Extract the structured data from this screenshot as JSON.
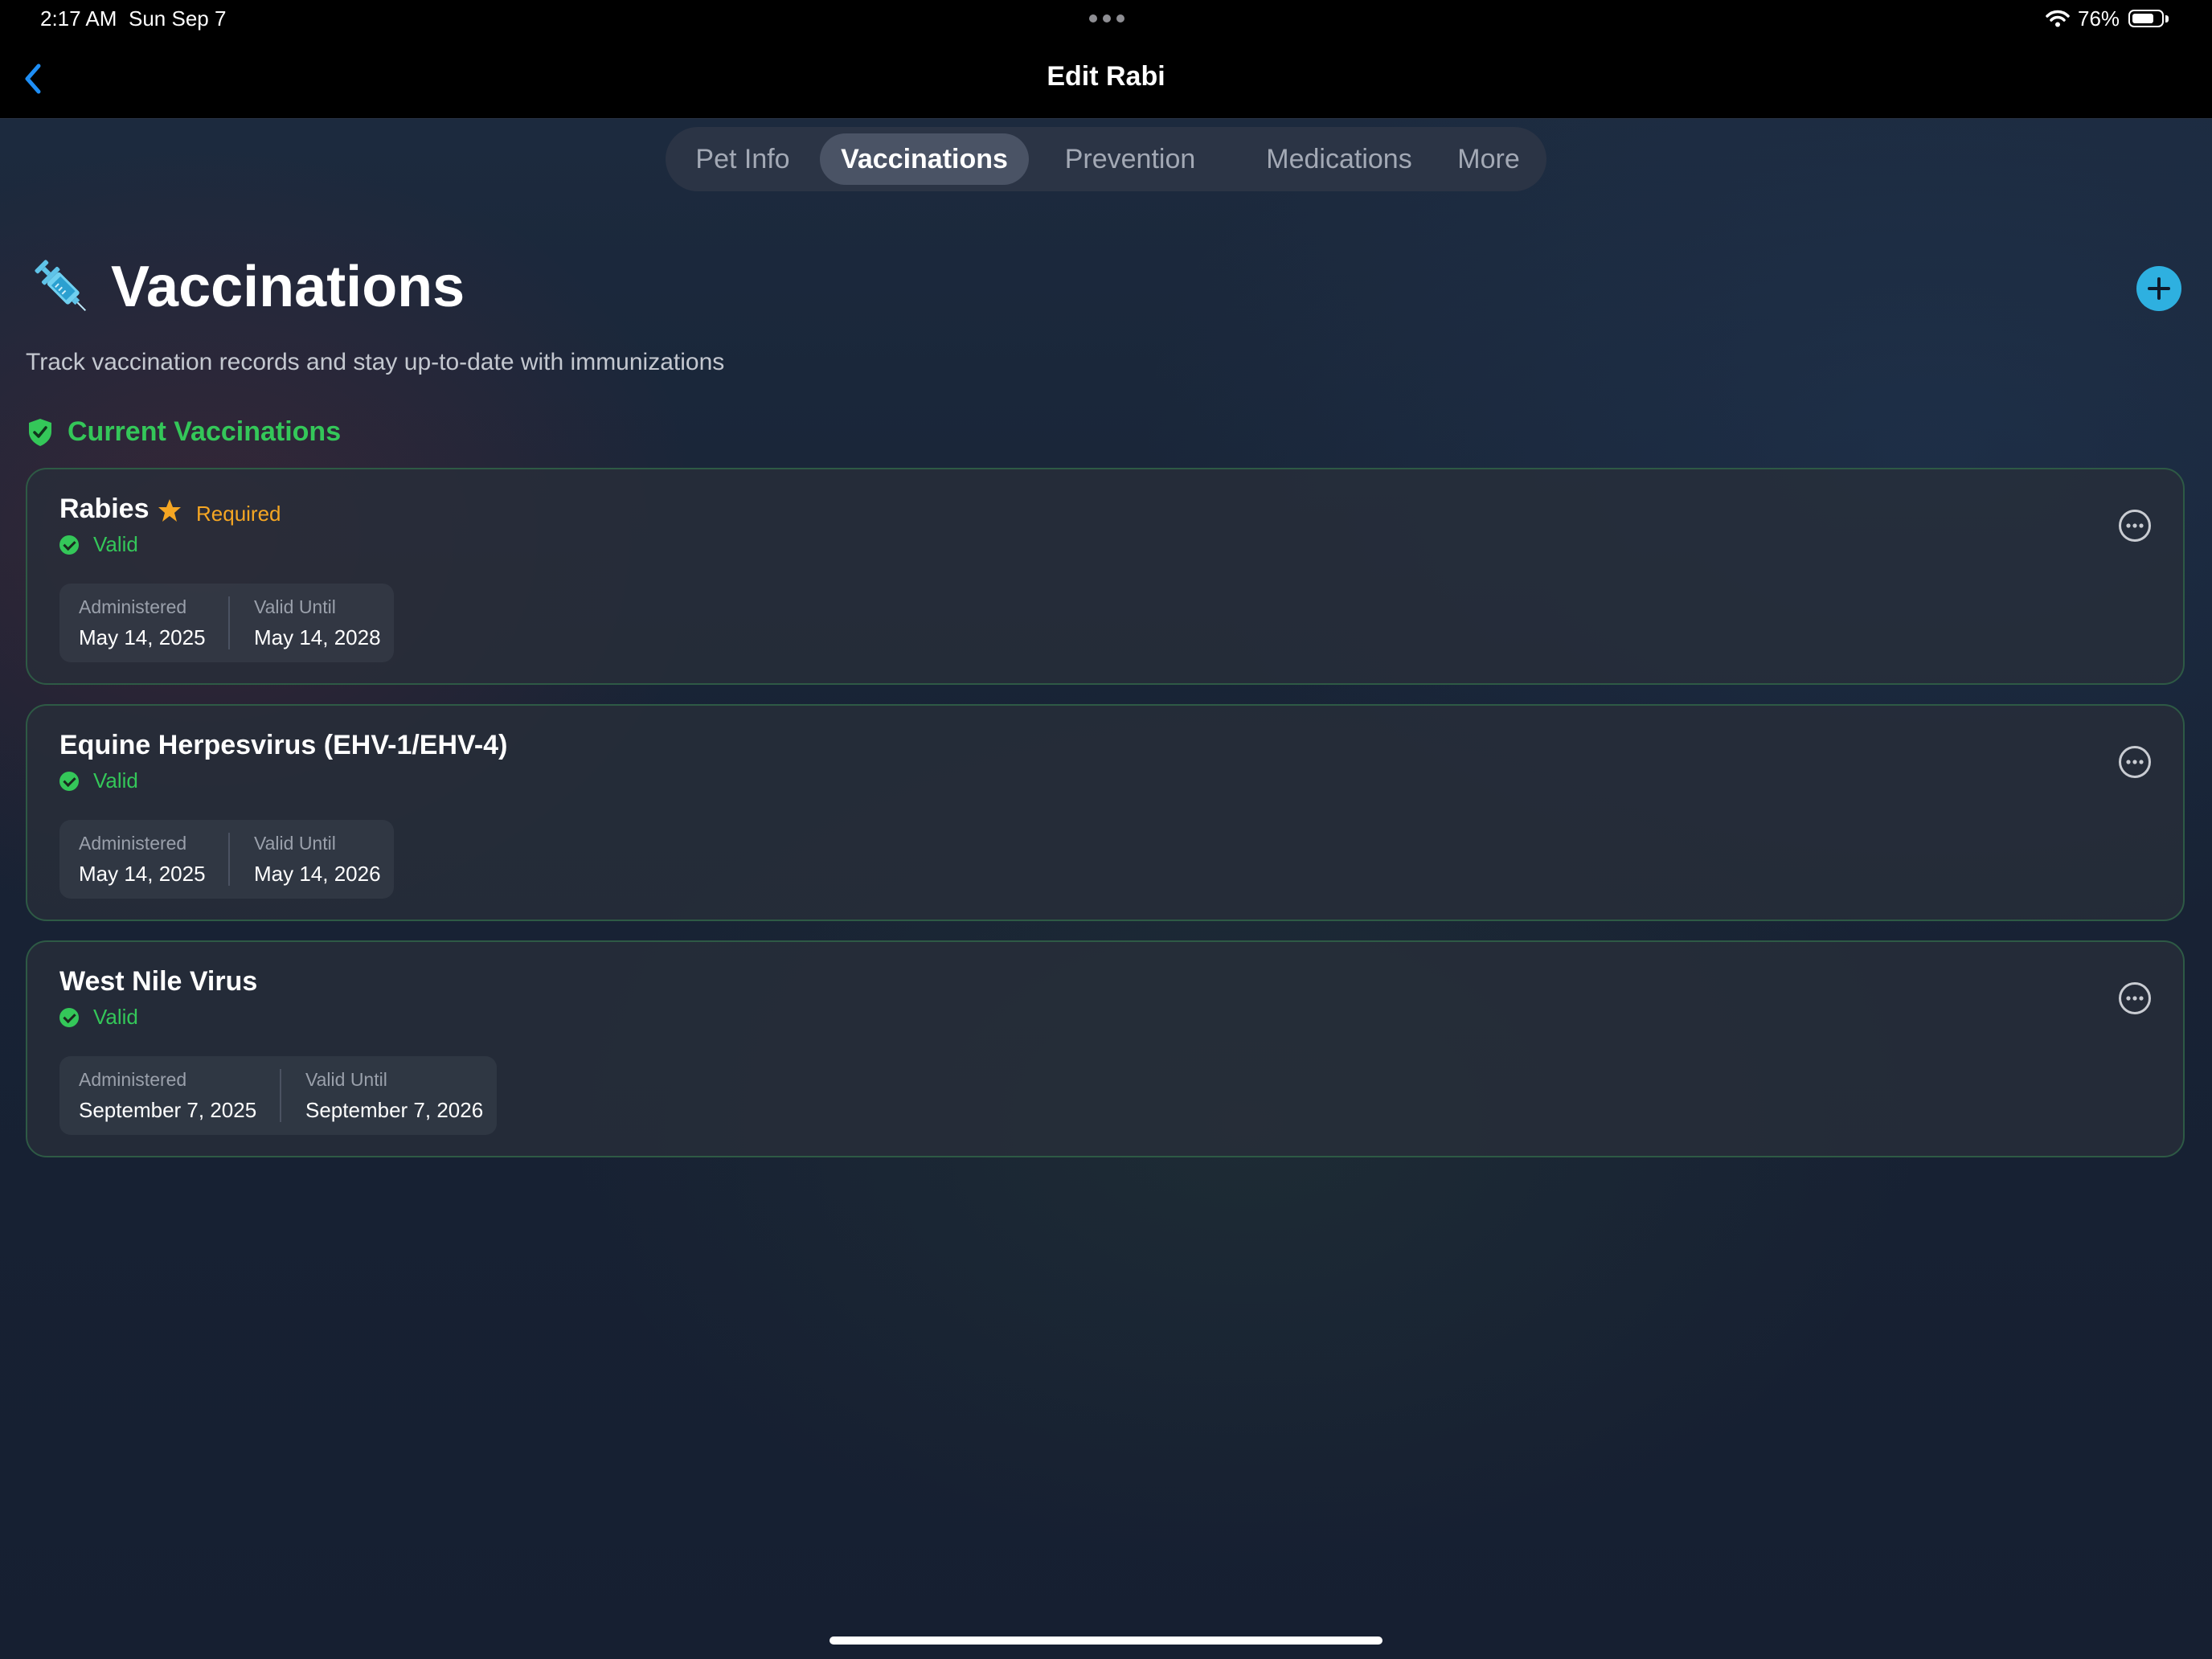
{
  "status_bar": {
    "time": "2:17 AM",
    "date": "Sun Sep 7",
    "battery_percent": "76%",
    "battery_level": 0.76
  },
  "nav": {
    "title": "Edit Rabi"
  },
  "tabs": [
    {
      "label": "Pet Info",
      "active": false
    },
    {
      "label": "Vaccinations",
      "active": true
    },
    {
      "label": "Prevention",
      "active": false
    },
    {
      "label": "Medications",
      "active": false
    },
    {
      "label": "More",
      "active": false
    }
  ],
  "header": {
    "icon": "syringe-icon",
    "title": "Vaccinations",
    "subtitle": "Track vaccination records and stay up-to-date with immunizations"
  },
  "section": {
    "icon": "shield-check-icon",
    "title": "Current Vaccinations"
  },
  "vaccinations": [
    {
      "name": "Rabies",
      "required_label": "Required",
      "status": "Valid",
      "administered_label": "Administered",
      "administered": "May 14, 2025",
      "valid_until_label": "Valid Until",
      "valid_until": "May 14, 2028"
    },
    {
      "name": "Equine Herpesvirus (EHV-1/EHV-4)",
      "status": "Valid",
      "administered_label": "Administered",
      "administered": "May 14, 2025",
      "valid_until_label": "Valid Until",
      "valid_until": "May 14, 2026"
    },
    {
      "name": "West Nile Virus",
      "status": "Valid",
      "administered_label": "Administered",
      "administered": "September 7, 2025",
      "valid_until_label": "Valid Until",
      "valid_until": "September 7, 2026"
    }
  ],
  "colors": {
    "accent": "#2eb0e0",
    "valid": "#34c759",
    "required": "#f5a623",
    "back": "#1e8ef5"
  }
}
